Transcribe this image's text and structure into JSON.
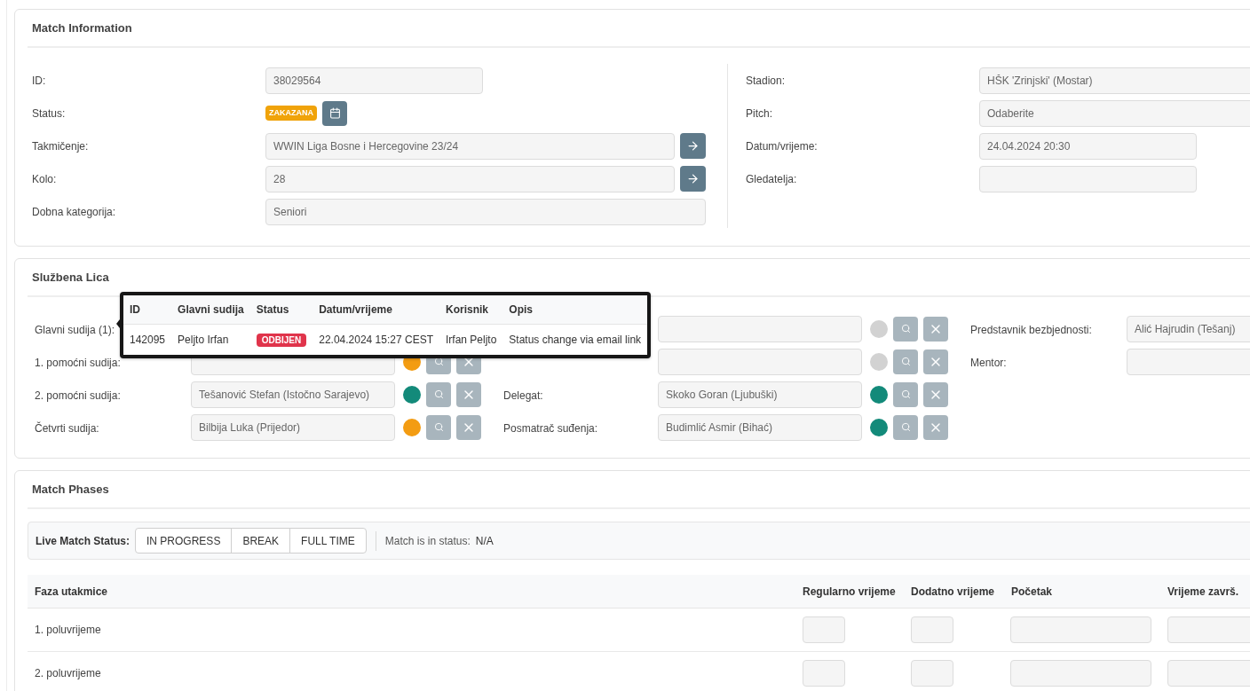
{
  "match_information": {
    "title": "Match Information",
    "left_fields": [
      {
        "label": "ID:",
        "kind": "short",
        "value": "38029564"
      },
      {
        "label": "Status:",
        "kind": "status",
        "status": "ZAKAZANA"
      },
      {
        "label": "Takmičenje:",
        "kind": "link",
        "value": "WWIN Liga Bosne i Hercegovine 23/24"
      },
      {
        "label": "Kolo:",
        "kind": "link",
        "value": "28"
      },
      {
        "label": "Dobna kategorija:",
        "kind": "full",
        "value": "Seniori"
      }
    ],
    "right_fields": [
      {
        "label": "Stadion:",
        "kind": "wide",
        "value": "HŠK 'Zrinjski' (Mostar)"
      },
      {
        "label": "Pitch:",
        "kind": "wide",
        "value": "Odaberite"
      },
      {
        "label": "Datum/vrijeme:",
        "kind": "short",
        "value": "24.04.2024 20:30"
      },
      {
        "label": "Gledatelja:",
        "kind": "short"
      }
    ]
  },
  "officials": {
    "title": "Službena Lica",
    "columns": [
      [
        {
          "kind": "covered",
          "label": "Glavni sudija (1):"
        },
        {
          "kind": "official",
          "label": "1. pomoćni sudija:",
          "color": "#f39c12"
        },
        {
          "kind": "official",
          "label": "2. pomoćni sudija:",
          "value": "Tešanović Stefan (Istočno Sarajevo)",
          "color": "#138a7a"
        },
        {
          "kind": "official",
          "label": "Četvrti sudija:",
          "value": "Bilbija Luka (Prijedor)",
          "color": "#f39c12"
        }
      ],
      [
        {
          "kind": "official",
          "color": "#d2d2d2"
        },
        {
          "kind": "official",
          "color": "#d2d2d2"
        },
        {
          "kind": "official",
          "label": "Delegat:",
          "value": "Skoko Goran (Ljubuški)",
          "color": "#138a7a"
        },
        {
          "kind": "official",
          "label": "Posmatrač suđenja:",
          "value": "Budimlić Asmir (Bihać)",
          "color": "#138a7a"
        }
      ],
      [
        {
          "kind": "field",
          "label": "Predstavnik bezbjednosti:",
          "value": "Alić Hajrudin (Tešanj)"
        },
        {
          "kind": "field",
          "label": "Mentor:"
        }
      ]
    ],
    "popup": {
      "columns": [
        "ID",
        "Glavni sudija",
        "Status",
        "Datum/vrijeme",
        "Korisnik",
        "Opis"
      ],
      "rows": [
        {
          "cells": [
            {
              "kind": "text",
              "text": "142095"
            },
            {
              "kind": "text",
              "text": "Peljto Irfan"
            },
            {
              "kind": "badge",
              "text": "ODBIJEN"
            },
            {
              "kind": "text",
              "text": "22.04.2024 15:27 CEST"
            },
            {
              "kind": "text",
              "text": "Irfan Peljto"
            },
            {
              "kind": "text",
              "text": "Status change via email link"
            }
          ]
        }
      ]
    }
  },
  "match_phases": {
    "title": "Match Phases",
    "live_label": "Live Match Status:",
    "live_buttons": [
      {
        "label": "IN PROGRESS",
        "selected": false
      },
      {
        "label": "BREAK",
        "selected": false
      },
      {
        "label": "FULL TIME",
        "selected": false
      }
    ],
    "status_label": "Match is in status:",
    "status_value": "N/A",
    "table": {
      "columns": [
        "Faza utakmice",
        "Regularno vrijeme",
        "Dodatno vrijeme",
        "Početak",
        "Vrijeme završ."
      ],
      "rows": [
        {
          "phase": "1. poluvrijeme"
        },
        {
          "phase": "2. poluvrijeme"
        }
      ]
    }
  }
}
